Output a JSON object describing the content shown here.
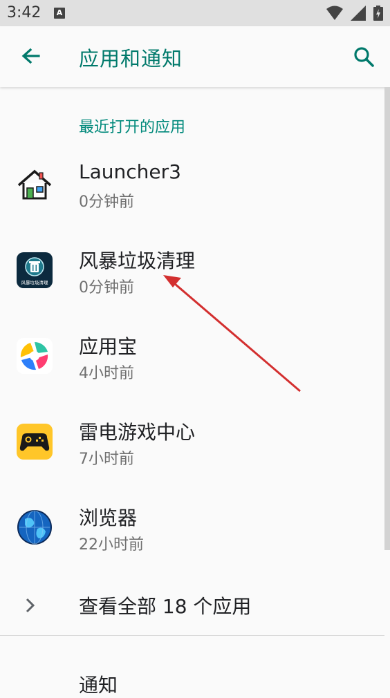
{
  "status_bar": {
    "time": "3:42",
    "notification_icon": "A"
  },
  "app_bar": {
    "title": "应用和通知",
    "back_icon": "arrow-back-icon",
    "search_icon": "search-icon"
  },
  "recent": {
    "header": "最近打开的应用",
    "apps": [
      {
        "name": "Launcher3",
        "time": "0分钟前",
        "icon": "house-icon"
      },
      {
        "name": "风暴垃圾清理",
        "time": "0分钟前",
        "icon": "trash-cleaner-icon",
        "icon_caption": "风暴垃圾清理"
      },
      {
        "name": "应用宝",
        "time": "4小时前",
        "icon": "app-store-icon"
      },
      {
        "name": "雷电游戏中心",
        "time": "7小时前",
        "icon": "gamepad-icon"
      },
      {
        "name": "浏览器",
        "time": "22小时前",
        "icon": "globe-icon"
      }
    ]
  },
  "see_all": {
    "label": "查看全部 18 个应用"
  },
  "notification": {
    "label": "通知"
  },
  "colors": {
    "accent": "#00796b",
    "annotation_arrow": "#d32f2f"
  }
}
